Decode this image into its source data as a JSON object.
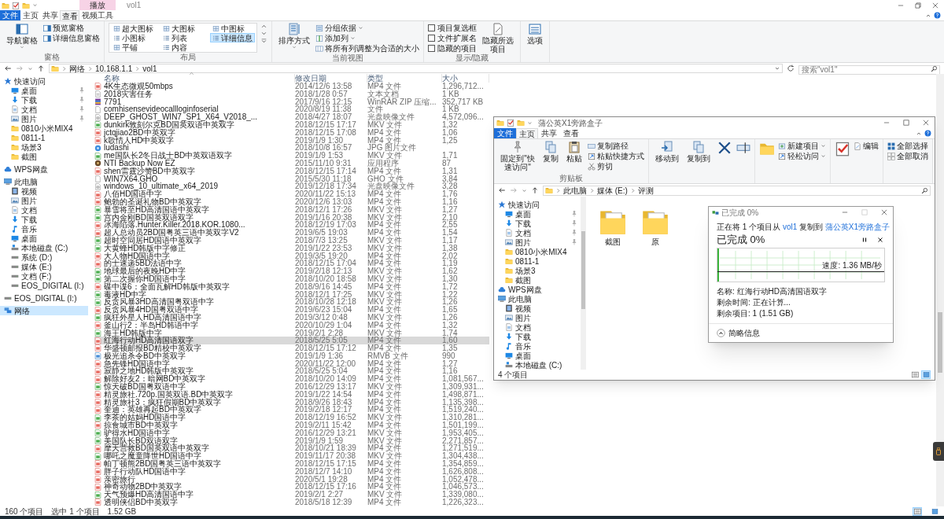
{
  "title_bar": {
    "context_tab": "播放",
    "title": "vol1"
  },
  "ribbon_tabs": [
    {
      "label": "文件",
      "kind": "file",
      "selected": false
    },
    {
      "label": "主页",
      "kind": "tab",
      "selected": false
    },
    {
      "label": "共享",
      "kind": "tab",
      "selected": false
    },
    {
      "label": "查看",
      "kind": "tab",
      "selected": true
    },
    {
      "label": "视频工具",
      "kind": "tab",
      "selected": false
    }
  ],
  "ribbon": {
    "panes": {
      "label": "窗格",
      "navigation": "导航窗格",
      "preview": "预览窗格",
      "details": "详细信息窗格"
    },
    "layout": {
      "label": "布局",
      "options": [
        {
          "label": "超大图标",
          "selected": false
        },
        {
          "label": "大图标",
          "selected": false
        },
        {
          "label": "中图标",
          "selected": false
        },
        {
          "label": "小图标",
          "selected": false
        },
        {
          "label": "列表",
          "selected": false
        },
        {
          "label": "详细信息",
          "selected": true
        },
        {
          "label": "平铺",
          "selected": false
        },
        {
          "label": "内容",
          "selected": false
        }
      ]
    },
    "current_view": {
      "label": "当前视图",
      "sort": "排序方式",
      "group_by": "分组依据",
      "add_column": "添加列",
      "fit_columns": "将所有列调整为合适的大小"
    },
    "show_hide": {
      "label": "显示/隐藏",
      "checks": [
        {
          "label": "项目复选框",
          "checked": false
        },
        {
          "label": "文件扩展名",
          "checked": false
        },
        {
          "label": "隐藏的项目",
          "checked": false
        }
      ],
      "hide_selected": "隐藏所选项目"
    },
    "options": "选项"
  },
  "address_bar": {
    "path": [
      "网络",
      "10.168.1.1",
      "vol1"
    ],
    "search_placeholder": "搜索\"vol1\""
  },
  "sidebar": {
    "items": [
      {
        "label": "快速访问",
        "kind": "star",
        "selected": false,
        "children": [
          {
            "label": "桌面",
            "kind": "desktop",
            "pinned": true,
            "selected": false
          },
          {
            "label": "下载",
            "kind": "download",
            "pinned": true,
            "selected": false
          },
          {
            "label": "文档",
            "kind": "document",
            "pinned": true,
            "selected": false
          },
          {
            "label": "图片",
            "kind": "picture",
            "pinned": true,
            "selected": false
          },
          {
            "label": "0810小米MIX4",
            "kind": "folder",
            "pinned": false,
            "selected": false
          },
          {
            "label": "0811-1",
            "kind": "folder",
            "pinned": false,
            "selected": false
          },
          {
            "label": "场景3",
            "kind": "folder",
            "pinned": false,
            "selected": false
          },
          {
            "label": "截图",
            "kind": "folder",
            "pinned": false,
            "selected": false
          }
        ]
      },
      {
        "label": "WPS网盘",
        "kind": "cloud",
        "selected": false
      },
      {
        "label": "此电脑",
        "kind": "pc",
        "selected": false,
        "children": [
          {
            "label": "视频",
            "kind": "video",
            "selected": false
          },
          {
            "label": "图片",
            "kind": "picture",
            "selected": false
          },
          {
            "label": "文档",
            "kind": "document",
            "selected": false
          },
          {
            "label": "下载",
            "kind": "download",
            "selected": false
          },
          {
            "label": "音乐",
            "kind": "music",
            "selected": false
          },
          {
            "label": "桌面",
            "kind": "desktop",
            "selected": false
          },
          {
            "label": "本地磁盘 (C:)",
            "kind": "sysdrive",
            "selected": false
          },
          {
            "label": "系统 (D:)",
            "kind": "drive",
            "selected": false
          },
          {
            "label": "媒体 (E:)",
            "kind": "drive",
            "selected": false
          },
          {
            "label": "文档 (F:)",
            "kind": "drive",
            "selected": false
          },
          {
            "label": "EOS_DIGITAL (I:)",
            "kind": "drive",
            "selected": false
          }
        ]
      },
      {
        "label": "EOS_DIGITAL (I:)",
        "kind": "drive",
        "selected": false
      },
      {
        "label": "网络",
        "kind": "network",
        "selected": true
      }
    ]
  },
  "file_list": {
    "columns": [
      "名称",
      "修改日期",
      "类型",
      "大小"
    ],
    "rows": [
      {
        "name": "4K生态微观50mbps",
        "date": "2014/12/6 13:58",
        "type": "MP4 文件",
        "size": "1,296,712...",
        "kind": "mp4",
        "selected": false
      },
      {
        "name": "2018灾害任务",
        "date": "2018/1/28 0:57",
        "type": "文本文档",
        "size": "1 KB",
        "kind": "text",
        "selected": false
      },
      {
        "name": "7791",
        "date": "2017/9/16 12:15",
        "type": "WinRAR ZIP 压缩...",
        "size": "352,717 KB",
        "kind": "zip",
        "selected": false
      },
      {
        "name": "comhisensevideocallloginfoserial",
        "date": "2020/8/19 11:38",
        "type": "文件",
        "size": "1 KB",
        "kind": "file",
        "selected": false
      },
      {
        "name": "DEEP_GHOST_WIN7_SP1_X64_V2018_...",
        "date": "2018/4/27 18:07",
        "type": "光盘映像文件",
        "size": "4,572,096...",
        "kind": "iso",
        "selected": false
      },
      {
        "name": "dunkirk敦刻尔克BD国英双语中英双字",
        "date": "2018/12/15 17:17",
        "type": "MKV 文件",
        "size": "1,32",
        "kind": "mkv",
        "selected": false
      },
      {
        "name": "jctqjiao2BD中英双字",
        "date": "2018/12/15 17:08",
        "type": "MP4 文件",
        "size": "1,06",
        "kind": "mp4",
        "selected": false
      },
      {
        "name": "k歌情人HD中英双字",
        "date": "2019/1/9 1:30",
        "type": "MP4 文件",
        "size": "1,25",
        "kind": "mp4",
        "selected": false
      },
      {
        "name": "ludashi",
        "date": "2018/10/8 16:57",
        "type": "JPG 图片文件",
        "kind": "image",
        "selected": false
      },
      {
        "name": "me国队长2冬日战士BD中英双语双字",
        "date": "2019/1/9 1:53",
        "type": "MKV 文件",
        "size": "1,71",
        "kind": "mkv",
        "selected": false
      },
      {
        "name": "NTI Backup Now EZ",
        "date": "2015/11/10 9:31",
        "type": "应用程序",
        "size": "87",
        "kind": "app",
        "selected": false
      },
      {
        "name": "shen雷霆沙赞BD中英双字",
        "date": "2018/12/15 17:14",
        "type": "MP4 文件",
        "size": "1,31",
        "kind": "mp4",
        "selected": false
      },
      {
        "name": "WIN7X64.GHO",
        "date": "2015/5/30 11:18",
        "type": "GHO 文件",
        "size": "3,84",
        "kind": "file",
        "selected": false
      },
      {
        "name": "windows_10_ultimate_x64_2019",
        "date": "2019/12/18 17:34",
        "type": "光盘映像文件",
        "size": "3,28",
        "kind": "iso",
        "selected": false
      },
      {
        "name": "八佰HD国语中字",
        "date": "2020/11/22 15:13",
        "type": "MP4 文件",
        "size": "1,76",
        "kind": "mp4",
        "selected": false
      },
      {
        "name": "鲍勃的圣诞礼物BD中英双字",
        "date": "2020/12/6 13:03",
        "type": "MP4 文件",
        "size": "1,16",
        "kind": "mp4",
        "selected": false
      },
      {
        "name": "暴雪将至HD高清国语中英双字",
        "date": "2018/12/1 17:26",
        "type": "MKV 文件",
        "size": "1,27",
        "kind": "mkv",
        "selected": false
      },
      {
        "name": "宫内金刚BD国英双语双字",
        "date": "2019/1/16 20:38",
        "type": "MKV 文件",
        "size": "2,10",
        "kind": "mkv",
        "selected": false
      },
      {
        "name": "冰海陷落.Hunter.Killer.2018.KOR.1080...",
        "date": "2018/12/19 17:03",
        "type": "MP4 文件",
        "size": "2,55",
        "kind": "mp4",
        "selected": false
      },
      {
        "name": "超人总动员2BD国粤英三语中英双字V2",
        "date": "2019/6/5 19:03",
        "type": "MP4 文件",
        "size": "1,54",
        "kind": "mp4",
        "selected": false
      },
      {
        "name": "超时空同居HD国语中英双字",
        "date": "2018/7/3 13:25",
        "type": "MKV 文件",
        "size": "1,17",
        "kind": "mkv",
        "selected": false
      },
      {
        "name": "大黄蜂HD韩版中字修正",
        "date": "2019/1/22 23:53",
        "type": "MKV 文件",
        "size": "1,38",
        "kind": "mkv",
        "selected": false
      },
      {
        "name": "大人物HD国语中字",
        "date": "2019/3/5 19:20",
        "type": "MP4 文件",
        "size": "2,02",
        "kind": "mp4",
        "selected": false
      },
      {
        "name": "的士速递5BD法语中字",
        "date": "2018/12/15 17:04",
        "type": "MP4 文件",
        "size": "1,19",
        "kind": "mp4",
        "selected": false
      },
      {
        "name": "地球最后的夜晚HD中字",
        "date": "2019/2/18 12:13",
        "type": "MKV 文件",
        "size": "1,62",
        "kind": "mkv",
        "selected": false
      },
      {
        "name": "第二次握你HD国语中字",
        "date": "2018/10/20 18:58",
        "type": "MKV 文件",
        "size": "1,30",
        "kind": "mkv",
        "selected": false
      },
      {
        "name": "碟中谍6：全面瓦解HD韩版中英双字",
        "date": "2018/9/16 14:45",
        "type": "MP4 文件",
        "size": "1,72",
        "kind": "mp4",
        "selected": false
      },
      {
        "name": "毒液HD中字",
        "date": "2018/12/1 17:25",
        "type": "MKV 文件",
        "size": "1,22",
        "kind": "mkv",
        "selected": false
      },
      {
        "name": "反贪风暴3HD高清国粤双语中字",
        "date": "2018/10/28 12:18",
        "type": "MKV 文件",
        "size": "1,26",
        "kind": "mkv",
        "selected": false
      },
      {
        "name": "反贪风暴4HD国粤双语中字",
        "date": "2019/6/23 15:04",
        "type": "MP4 文件",
        "size": "1,65",
        "kind": "mp4",
        "selected": false
      },
      {
        "name": "疯狂外星人HD高清国语中字",
        "date": "2019/3/12 0:48",
        "type": "MKV 文件",
        "size": "1,26",
        "kind": "mkv",
        "selected": false
      },
      {
        "name": "釜山行2：半岛HD韩语中字",
        "date": "2020/10/29 1:04",
        "type": "MP4 文件",
        "size": "1,32",
        "kind": "mp4",
        "selected": false
      },
      {
        "name": "海王HD韩版中字",
        "date": "2019/2/1 2:28",
        "type": "MKV 文件",
        "size": "1,74",
        "kind": "mkv",
        "selected": false
      },
      {
        "name": "红海行动HD高清国语双字",
        "date": "2018/5/25 5:05",
        "type": "MP4 文件",
        "size": "1,60",
        "kind": "mp4",
        "selected": true
      },
      {
        "name": "华盛顿邮报BD精校中英双字",
        "date": "2018/12/15 17:12",
        "type": "MP4 文件",
        "size": "1,35",
        "kind": "mp4",
        "selected": false
      },
      {
        "name": "极光追杀令BD中英双字",
        "date": "2019/1/9 1:36",
        "type": "RMVB 文件",
        "size": "990",
        "kind": "rmvb",
        "selected": false
      },
      {
        "name": "急先锋HD国语中字",
        "date": "2020/11/22 12:00",
        "type": "MP4 文件",
        "size": "1,27",
        "kind": "mp4",
        "selected": false
      },
      {
        "name": "寂静之地HD韩版中英双字",
        "date": "2018/5/25 5:04",
        "type": "MP4 文件",
        "size": "1,16",
        "kind": "mp4",
        "selected": false
      },
      {
        "name": "解除好友2：暗网BD中英双字",
        "date": "2018/10/20 14:09",
        "type": "MP4 文件",
        "size": "1,081,567...",
        "kind": "mp4",
        "selected": false
      },
      {
        "name": "惊天破BD国粤双语中字",
        "date": "2016/12/29 13:17",
        "type": "MKV 文件",
        "size": "1,309,931...",
        "kind": "mkv",
        "selected": false
      },
      {
        "name": "精灵旅社.720p.国英双语.BD中英双字",
        "date": "2019/1/22 14:54",
        "type": "MP4 文件",
        "size": "1,498,871...",
        "kind": "mp4",
        "selected": false
      },
      {
        "name": "精灵旅社3：疯狂假期BD中英双字",
        "date": "2018/9/26 18:43",
        "type": "MP4 文件",
        "size": "1,135,398...",
        "kind": "mp4",
        "selected": false
      },
      {
        "name": "奎迪：英雄再起BD中英双字",
        "date": "2019/2/18 12:17",
        "type": "MP4 文件",
        "size": "1,519,240...",
        "kind": "mp4",
        "selected": false
      },
      {
        "name": "李茶的姑妈HD国语中字",
        "date": "2018/12/19 16:52",
        "type": "MKV 文件",
        "size": "1,310,281...",
        "kind": "mkv",
        "selected": false
      },
      {
        "name": "掠食城市BD中英双字",
        "date": "2019/2/11 15:42",
        "type": "MP4 文件",
        "size": "1,501,199...",
        "kind": "mp4",
        "selected": false
      },
      {
        "name": "驴得水HD国语中字",
        "date": "2016/12/29 13:21",
        "type": "MKV 文件",
        "size": "1,953,405...",
        "kind": "mkv",
        "selected": false
      },
      {
        "name": "美国队长BD双语双字",
        "date": "2019/1/9 1:59",
        "type": "MKV 文件",
        "size": "2,271,857...",
        "kind": "mkv",
        "selected": false
      },
      {
        "name": "摩天营救BD国英双语中英双字",
        "date": "2018/10/21 18:39",
        "type": "MP4 文件",
        "size": "1,271,519...",
        "kind": "mp4",
        "selected": false
      },
      {
        "name": "哪吒之魔童降世HD国语中字",
        "date": "2019/11/17 20:38",
        "type": "MKV 文件",
        "size": "1,304,438...",
        "kind": "mkv",
        "selected": false
      },
      {
        "name": "帕丁顿熊2BD国粤英三语中英双字",
        "date": "2018/12/15 17:15",
        "type": "MP4 文件",
        "size": "1,354,859...",
        "kind": "mp4",
        "selected": false
      },
      {
        "name": "胖子行动队HD国语中字",
        "date": "2018/12/7 14:10",
        "type": "MP4 文件",
        "size": "1,626,808...",
        "kind": "mp4",
        "selected": false
      },
      {
        "name": "亲密旅行",
        "date": "2020/5/1 19:28",
        "type": "MP4 文件",
        "size": "1,052,478...",
        "kind": "mp4",
        "selected": false
      },
      {
        "name": "神奇动物2BD中英双字",
        "date": "2018/12/15 17:16",
        "type": "MP4 文件",
        "size": "1,046,573...",
        "kind": "mp4",
        "selected": false
      },
      {
        "name": "天气预爆HD高清国语中字",
        "date": "2019/2/1 2:27",
        "type": "MKV 文件",
        "size": "1,339,080...",
        "kind": "mkv",
        "selected": false
      },
      {
        "name": "透明侠侣BD中英双字",
        "date": "2018/5/18 12:39",
        "type": "MP4 文件",
        "size": "1,226,323...",
        "kind": "mp4",
        "selected": false
      }
    ]
  },
  "status_bar": {
    "item_count": "160 个项目",
    "selection": "选中 1 个项目",
    "selection_size": "1.52 GB",
    "views": [
      {
        "kind": "details",
        "selected": true
      },
      {
        "kind": "large_icons",
        "selected": false
      }
    ]
  },
  "copy_target_window": {
    "title": "蒲公英X1旁路盒子",
    "ribbon_tabs": [
      {
        "label": "文件",
        "kind": "file",
        "selected": false
      },
      {
        "label": "主页",
        "kind": "tab",
        "selected": true
      },
      {
        "label": "共享",
        "kind": "tab",
        "selected": false
      },
      {
        "label": "查看",
        "kind": "tab",
        "selected": false
      }
    ],
    "ribbon": {
      "pin": "固定到\"快速访问\"",
      "copy": "复制",
      "paste": "粘贴",
      "copy_path": "复制路径",
      "paste_shortcut": "粘贴快捷方式",
      "cut": "剪切",
      "clipboard_label": "剪贴板",
      "move_to": "移动到",
      "copy_to": "复制到",
      "new_item": "新建项目",
      "easy_access": "轻松访问",
      "edit": "编辑",
      "select_all": "全部选择",
      "select_none": "全部取消"
    },
    "path": [
      "此电脑",
      "媒体 (E:)",
      "评测"
    ],
    "sidebar": {
      "items": [
        {
          "label": "快速访问",
          "kind": "star",
          "selected": false,
          "children": [
            {
              "label": "桌面",
              "kind": "desktop",
              "pinned": true,
              "selected": false
            },
            {
              "label": "下载",
              "kind": "download",
              "pinned": true,
              "selected": false
            },
            {
              "label": "文档",
              "kind": "document",
              "pinned": true,
              "selected": false
            },
            {
              "label": "图片",
              "kind": "picture",
              "pinned": true,
              "selected": false
            },
            {
              "label": "0810小米MIX4",
              "kind": "folder",
              "pinned": false,
              "selected": false
            },
            {
              "label": "0811-1",
              "kind": "folder",
              "pinned": false,
              "selected": false
            },
            {
              "label": "场景3",
              "kind": "folder",
              "pinned": false,
              "selected": false
            },
            {
              "label": "截图",
              "kind": "folder",
              "pinned": false,
              "selected": false
            }
          ]
        },
        {
          "label": "WPS网盘",
          "kind": "cloud",
          "selected": false
        },
        {
          "label": "此电脑",
          "kind": "pc",
          "selected": false,
          "children": [
            {
              "label": "视频",
              "kind": "video",
              "selected": false
            },
            {
              "label": "图片",
              "kind": "picture",
              "selected": false
            },
            {
              "label": "文档",
              "kind": "document",
              "selected": false
            },
            {
              "label": "下载",
              "kind": "download",
              "selected": false
            },
            {
              "label": "音乐",
              "kind": "music",
              "selected": false
            },
            {
              "label": "桌面",
              "kind": "desktop",
              "selected": false
            },
            {
              "label": "本地磁盘 (C:)",
              "kind": "sysdrive",
              "selected": false
            }
          ]
        }
      ]
    },
    "folders": [
      {
        "label": "截图",
        "selected": false
      },
      {
        "label": "原",
        "selected": false
      }
    ],
    "status": "4 个项目",
    "views": [
      {
        "kind": "details",
        "selected": false
      },
      {
        "kind": "large_icons",
        "selected": true
      }
    ]
  },
  "copy_dialog": {
    "title": "已完成 0%",
    "source_prefix": "正在将 1 个项目从",
    "source": "vol1",
    "dest_prefix": "复制到",
    "destination": "蒲公英X1旁路盒子",
    "heading": "已完成 0%",
    "level": 0,
    "speed": "速度: 1.36 MB/秒",
    "name": "名称: 红海行动HD高清国语双字",
    "time_left": "剩余时间: 正在计算...",
    "items_left": "剩余项目: 1 (1.51 GB)",
    "details_toggle": "简略信息"
  }
}
